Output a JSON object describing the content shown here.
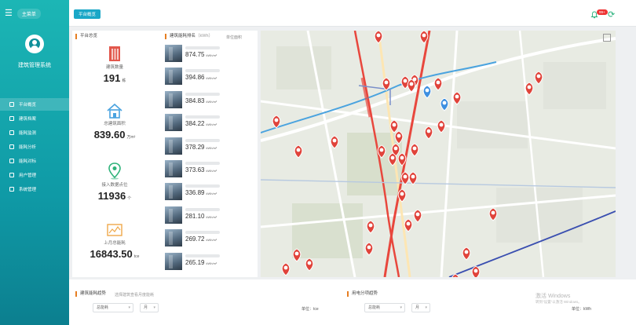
{
  "sidebar": {
    "menu_icon": "☰",
    "top_tag": "主菜单",
    "user_name": "建筑管理系统",
    "items": [
      {
        "label": "平台概览",
        "icon": "monitor-icon"
      },
      {
        "label": "建筑档案",
        "icon": "building-icon"
      },
      {
        "label": "能耗监测",
        "icon": "gauge-icon"
      },
      {
        "label": "能耗分析",
        "icon": "document-icon"
      },
      {
        "label": "能耗对标",
        "icon": "compare-icon"
      },
      {
        "label": "用户管理",
        "icon": "user-icon"
      },
      {
        "label": "系统管理",
        "icon": "settings-icon"
      }
    ]
  },
  "header": {
    "tab": "平台概览",
    "notification_count": "99+",
    "refresh_icon": "⟳"
  },
  "overview": {
    "title": "平台总览",
    "stats": [
      {
        "label": "建筑数量",
        "value": "191",
        "unit": "栋",
        "icon": "building-icon",
        "color": "#e2574c"
      },
      {
        "label": "总建筑面积",
        "value": "839.60",
        "unit": "万m²",
        "icon": "house-icon",
        "color": "#4aa3df"
      },
      {
        "label": "接入数据点位",
        "value": "11936",
        "unit": "个",
        "icon": "location-icon",
        "color": "#2fb37a"
      },
      {
        "label": "上月总能耗",
        "value": "16843.50",
        "unit": "tce",
        "icon": "energy-icon",
        "color": "#f0a94a"
      }
    ]
  },
  "ranking": {
    "title": "建筑能耗排名",
    "subtitle": "（kWh）",
    "action": "单位面积",
    "rows": [
      {
        "value": "874.75",
        "unit": "kWh/m²"
      },
      {
        "value": "394.86",
        "unit": "kWh/m²"
      },
      {
        "value": "384.83",
        "unit": "kWh/m²"
      },
      {
        "value": "384.22",
        "unit": "kWh/m²"
      },
      {
        "value": "378.29",
        "unit": "kWh/m²"
      },
      {
        "value": "373.63",
        "unit": "kWh/m²"
      },
      {
        "value": "336.89",
        "unit": "kWh/m²"
      },
      {
        "value": "281.10",
        "unit": "kWh/m²"
      },
      {
        "value": "269.72",
        "unit": "kWh/m²"
      },
      {
        "value": "265.19",
        "unit": "kWh/m²"
      }
    ]
  },
  "map": {
    "markers_red": 42,
    "markers_blue": 2,
    "fullscreen_icon": "expand-icon"
  },
  "bottom": {
    "left_title": "建筑能耗趋势",
    "left_sub": "选择建筑查看月度能耗",
    "left_select_1": "总能耗",
    "left_select_2": "月",
    "left_unit_label": "单位：tce",
    "right_title": "用电分项趋势",
    "right_select_1": "总能耗",
    "right_select_2": "月",
    "right_unit_label": "单位：kWh"
  },
  "watermark": {
    "line1": "激活 Windows",
    "line2": "转到\"设置\"以激活 Windows。"
  }
}
